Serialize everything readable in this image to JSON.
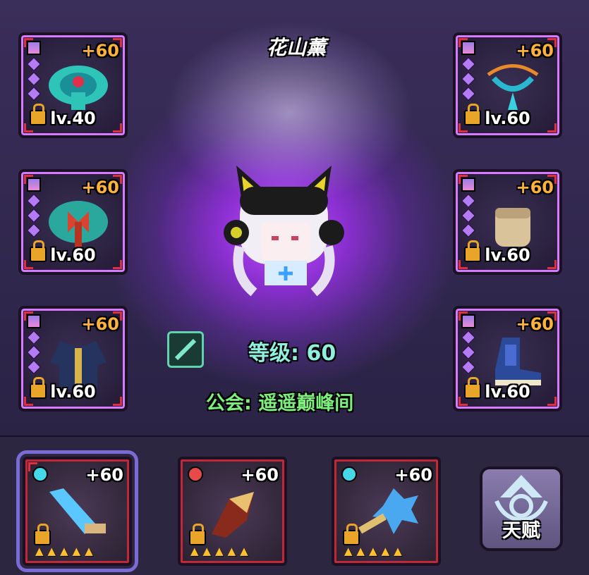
{
  "character": {
    "name": "花山薰",
    "level_text": "等级: 60",
    "guild_text": "公会: 遥遥巅峰间"
  },
  "equipment": {
    "left": [
      {
        "plus": "+60",
        "level": "lv.40",
        "icon": "peacock-armor-icon"
      },
      {
        "plus": "+60",
        "level": "lv.60",
        "icon": "bow-cape-icon"
      },
      {
        "plus": "+60",
        "level": "lv.60",
        "icon": "coat-icon"
      }
    ],
    "right": [
      {
        "plus": "+60",
        "level": "lv.60",
        "icon": "necklace-icon"
      },
      {
        "plus": "+60",
        "level": "lv.60",
        "icon": "gauntlet-icon"
      },
      {
        "plus": "+60",
        "level": "lv.60",
        "icon": "boots-icon"
      }
    ]
  },
  "weapons": [
    {
      "plus": "+60",
      "icon": "ice-sword-icon",
      "gem_color": "#45d8e8",
      "stars": 5
    },
    {
      "plus": "+60",
      "icon": "flame-gauntlet-icon",
      "gem_color": "#e84a4a",
      "stars": 5
    },
    {
      "plus": "+60",
      "icon": "frost-mace-icon",
      "gem_color": "#45d8e8",
      "stars": 5
    }
  ],
  "talent": {
    "label": "天赋",
    "icon": "talent-icon"
  },
  "colors": {
    "accent": "#d67bff",
    "level_cyan": "#8ff0e0",
    "guild_green": "#7cf07a",
    "plus_orange": "#ffb23a"
  }
}
